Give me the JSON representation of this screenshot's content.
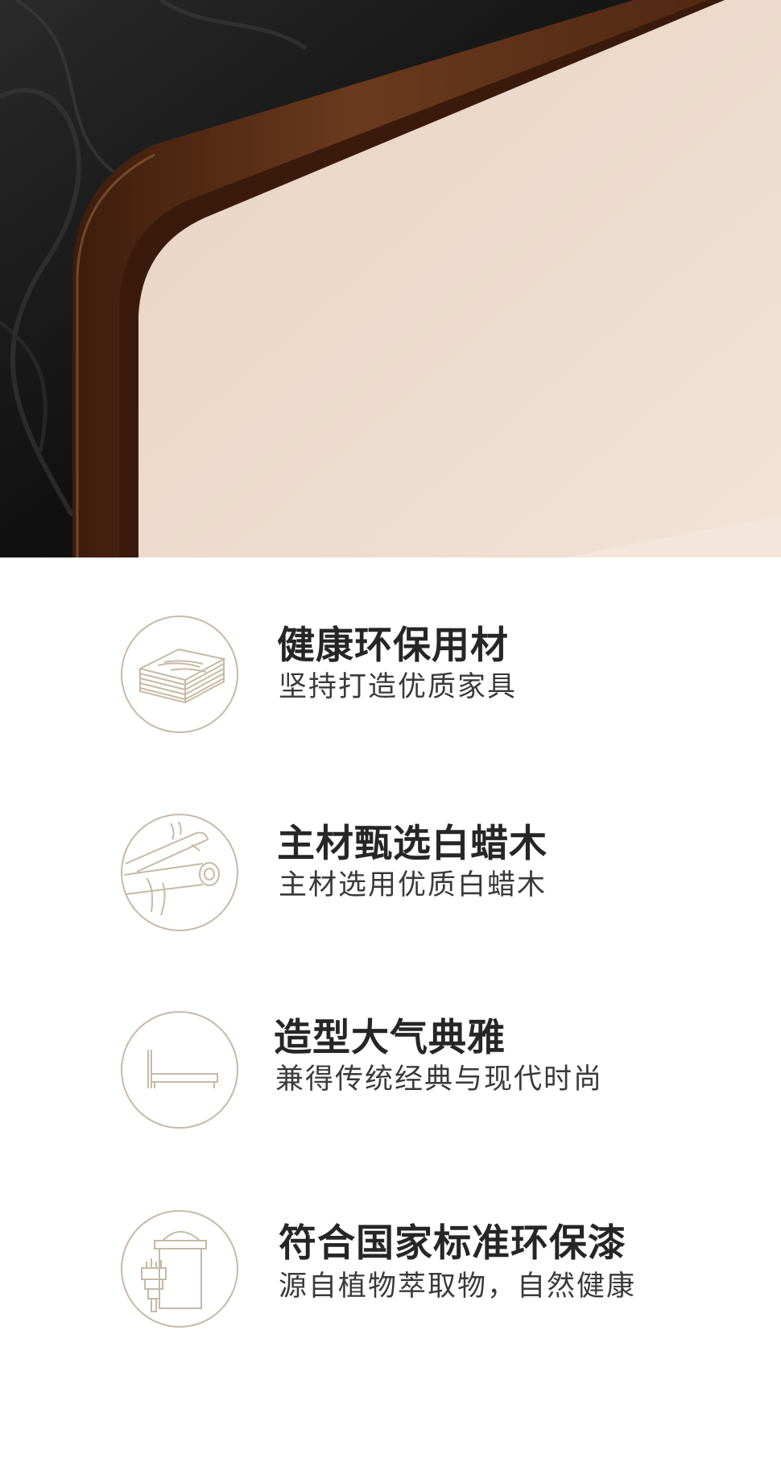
{
  "features": [
    {
      "icon": "wood-planks-icon",
      "title": "健康环保用材",
      "subtitle": "坚持打造优质家具"
    },
    {
      "icon": "log-icon",
      "title": "主材甄选白蜡木",
      "subtitle": "主材选用优质白蜡木"
    },
    {
      "icon": "bed-icon",
      "title": "造型大气典雅",
      "subtitle": "兼得传统经典与现代时尚"
    },
    {
      "icon": "paint-can-brush-icon",
      "title": "符合国家标准环保漆",
      "subtitle": "源自植物萃取物，自然健康"
    }
  ],
  "colors": {
    "icon_stroke": "#c7b9a6",
    "title": "#262626",
    "subtitle": "#3a3a3a",
    "frame_wood": "#5a3018",
    "cushion": "#ead7c7"
  }
}
